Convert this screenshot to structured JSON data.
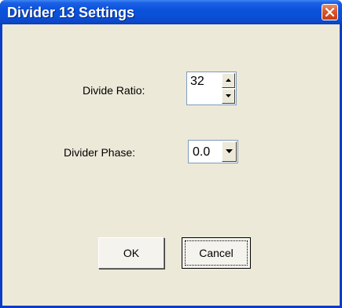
{
  "window": {
    "title": "Divider 13 Settings"
  },
  "fields": {
    "divide_ratio_label": "Divide Ratio:",
    "divide_ratio_value": "32",
    "divider_phase_label": "Divider Phase:",
    "divider_phase_value": "0.0"
  },
  "buttons": {
    "ok_label": "OK",
    "cancel_label": "Cancel"
  },
  "icons": {
    "close": "close-icon",
    "spin_up": "arrow-up-icon",
    "spin_down": "arrow-down-icon",
    "dropdown": "chevron-down-icon"
  },
  "colors": {
    "titlebar": "#0a52dc",
    "client_background": "#ece9d8",
    "close_button": "#d9572a"
  }
}
